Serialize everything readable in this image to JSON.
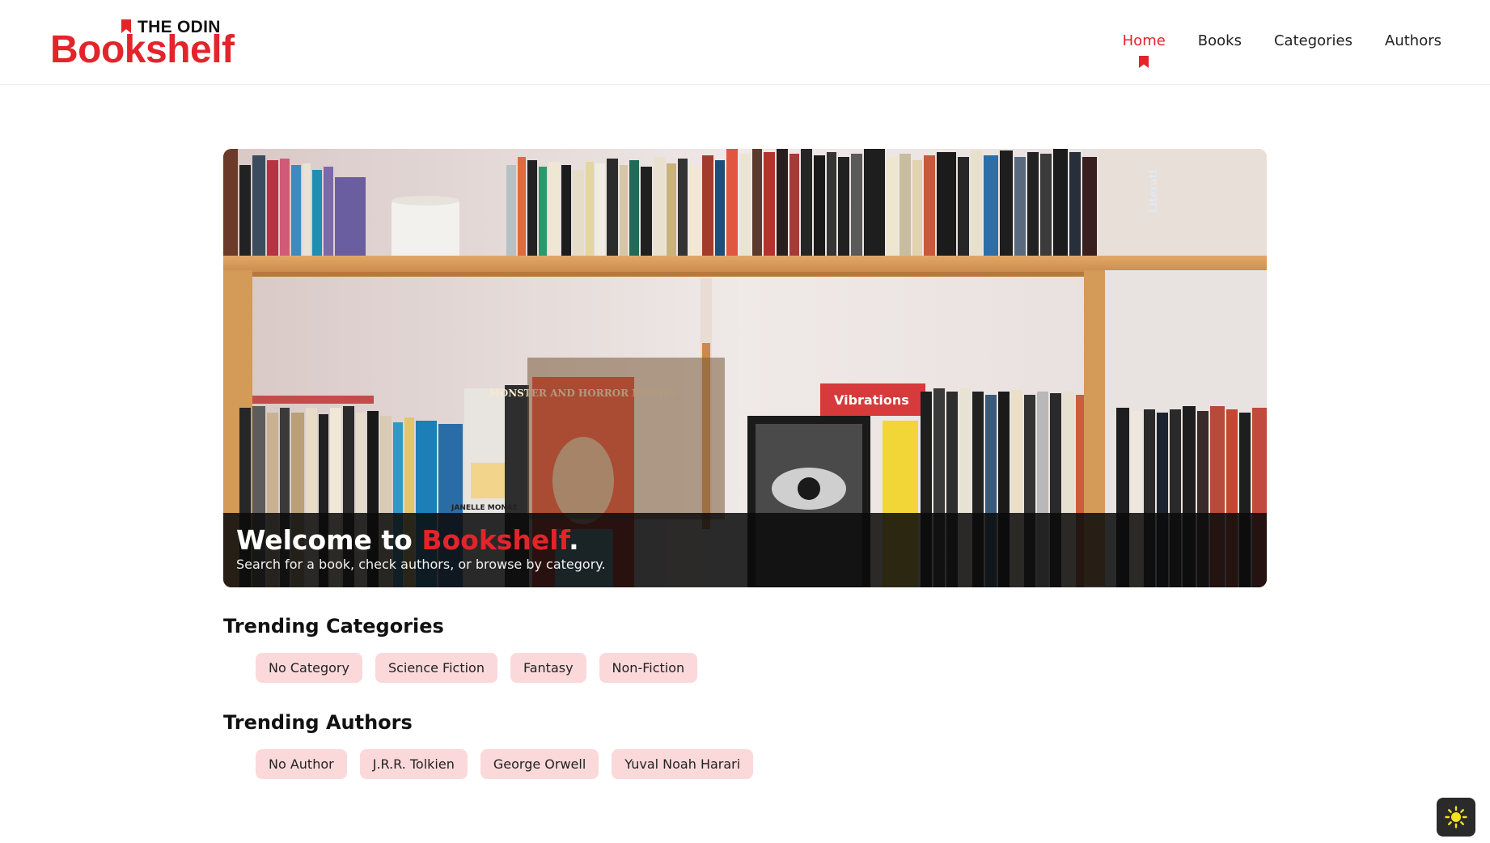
{
  "brand": {
    "top_text": "THE ODIN",
    "main_text": "Bookshelf",
    "accent_color": "#e3242b"
  },
  "nav": {
    "items": [
      {
        "label": "Home",
        "active": true
      },
      {
        "label": "Books",
        "active": false
      },
      {
        "label": "Categories",
        "active": false
      },
      {
        "label": "Authors",
        "active": false
      }
    ]
  },
  "hero": {
    "title_prefix": "Welcome to ",
    "title_accent": "Bookshelf",
    "title_suffix": ".",
    "subtitle": "Search for a book, check authors, or browse by category.",
    "book_covers": {
      "monster": "MONSTER AND HORROR MOVIES",
      "vibrations": "Vibrations",
      "monae": "JANELLE MONAE",
      "literati": "Literati"
    }
  },
  "trending_categories": {
    "title": "Trending Categories",
    "items": [
      "No Category",
      "Science Fiction",
      "Fantasy",
      "Non-Fiction"
    ]
  },
  "trending_authors": {
    "title": "Trending Authors",
    "items": [
      "No Author",
      "J.R.R. Tolkien",
      "George Orwell",
      "Yuval Noah Harari"
    ]
  },
  "theme_toggle": {
    "icon": "sun-icon"
  }
}
